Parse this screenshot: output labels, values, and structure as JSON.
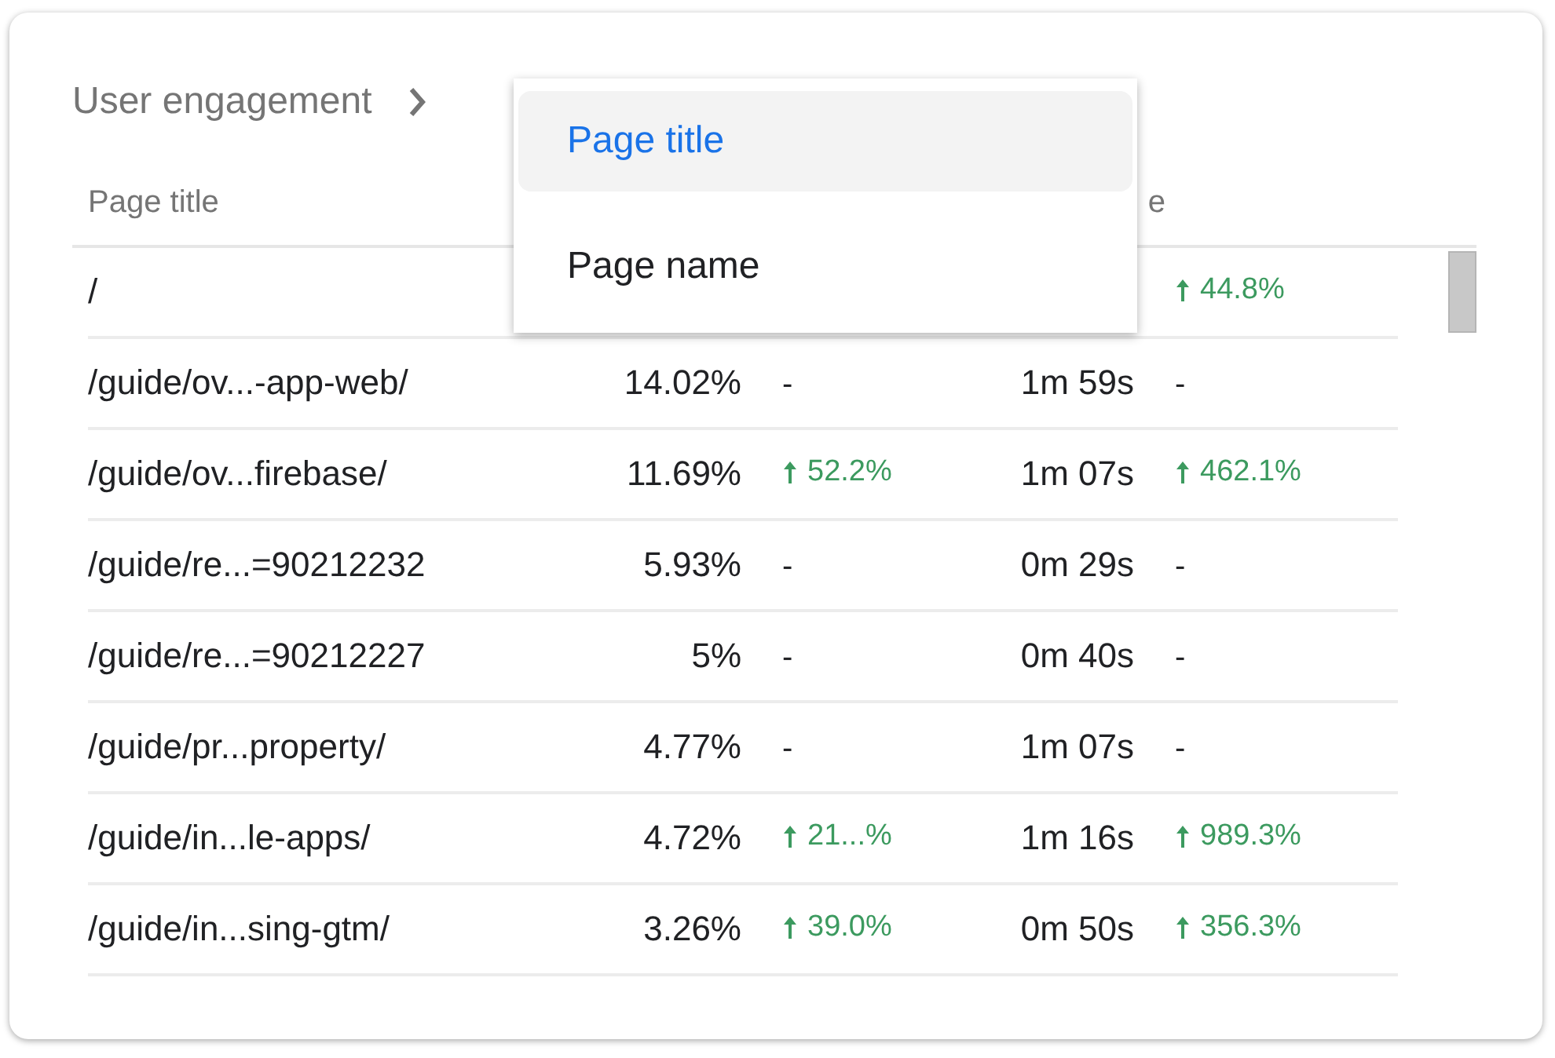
{
  "card": {
    "title": "User engagement"
  },
  "menu": {
    "items": [
      {
        "label": "Page title",
        "selected": true
      },
      {
        "label": "Page name",
        "selected": false
      }
    ]
  },
  "table": {
    "header": {
      "column_1": "Page title",
      "column_4": "e"
    },
    "rows": [
      {
        "page": "/",
        "change_2": {
          "text": "44.8%",
          "up": true
        }
      },
      {
        "page": "/guide/ov...-app-web/",
        "share": "14.02%",
        "change_1": {
          "text": "-",
          "up": false
        },
        "time": "1m 59s",
        "change_2": {
          "text": "-",
          "up": false
        }
      },
      {
        "page": "/guide/ov...firebase/",
        "share": "11.69%",
        "change_1": {
          "text": "52.2%",
          "up": true
        },
        "time": "1m 07s",
        "change_2": {
          "text": "462.1%",
          "up": true
        }
      },
      {
        "page": "/guide/re...=90212232",
        "share": "5.93%",
        "change_1": {
          "text": "-",
          "up": false
        },
        "time": "0m 29s",
        "change_2": {
          "text": "-",
          "up": false
        }
      },
      {
        "page": "/guide/re...=90212227",
        "share": "5%",
        "change_1": {
          "text": "-",
          "up": false
        },
        "time": "0m 40s",
        "change_2": {
          "text": "-",
          "up": false
        }
      },
      {
        "page": "/guide/pr...property/",
        "share": "4.77%",
        "change_1": {
          "text": "-",
          "up": false
        },
        "time": "1m 07s",
        "change_2": {
          "text": "-",
          "up": false
        }
      },
      {
        "page": "/guide/in...le-apps/",
        "share": "4.72%",
        "change_1": {
          "text": "21...%",
          "up": true
        },
        "time": "1m 16s",
        "change_2": {
          "text": "989.3%",
          "up": true
        }
      },
      {
        "page": "/guide/in...sing-gtm/",
        "share": "3.26%",
        "change_1": {
          "text": "39.0%",
          "up": true
        },
        "time": "0m 50s",
        "change_2": {
          "text": "356.3%",
          "up": true
        }
      }
    ]
  }
}
